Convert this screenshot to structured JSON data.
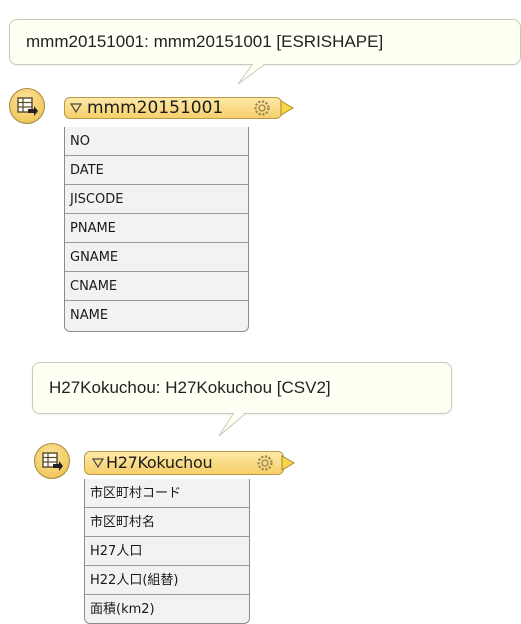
{
  "features": [
    {
      "annotation": "mmm20151001: mmm20151001 [ESRISHAPE]",
      "name": "mmm20151001",
      "attributes": [
        "NO",
        "DATE",
        "JISCODE",
        "PNAME",
        "GNAME",
        "CNAME",
        "NAME"
      ]
    },
    {
      "annotation": "H27Kokuchou: H27Kokuchou [CSV2]",
      "name": "H27Kokuchou",
      "attributes": [
        "市区町村コード",
        "市区町村名",
        "H27人口",
        "H22人口(組替)",
        "面積(km2)"
      ]
    }
  ],
  "icons": {
    "feature_type": "table-arrow-icon",
    "collapse": "triangle-down-icon",
    "properties": "gear-icon",
    "output_port": "output-port-triangle-icon"
  },
  "colors": {
    "header_fill": "#f6cf6a",
    "header_border": "#b89a48",
    "callout_fill": "#fffff4",
    "row_fill": "#f2f2f2"
  }
}
